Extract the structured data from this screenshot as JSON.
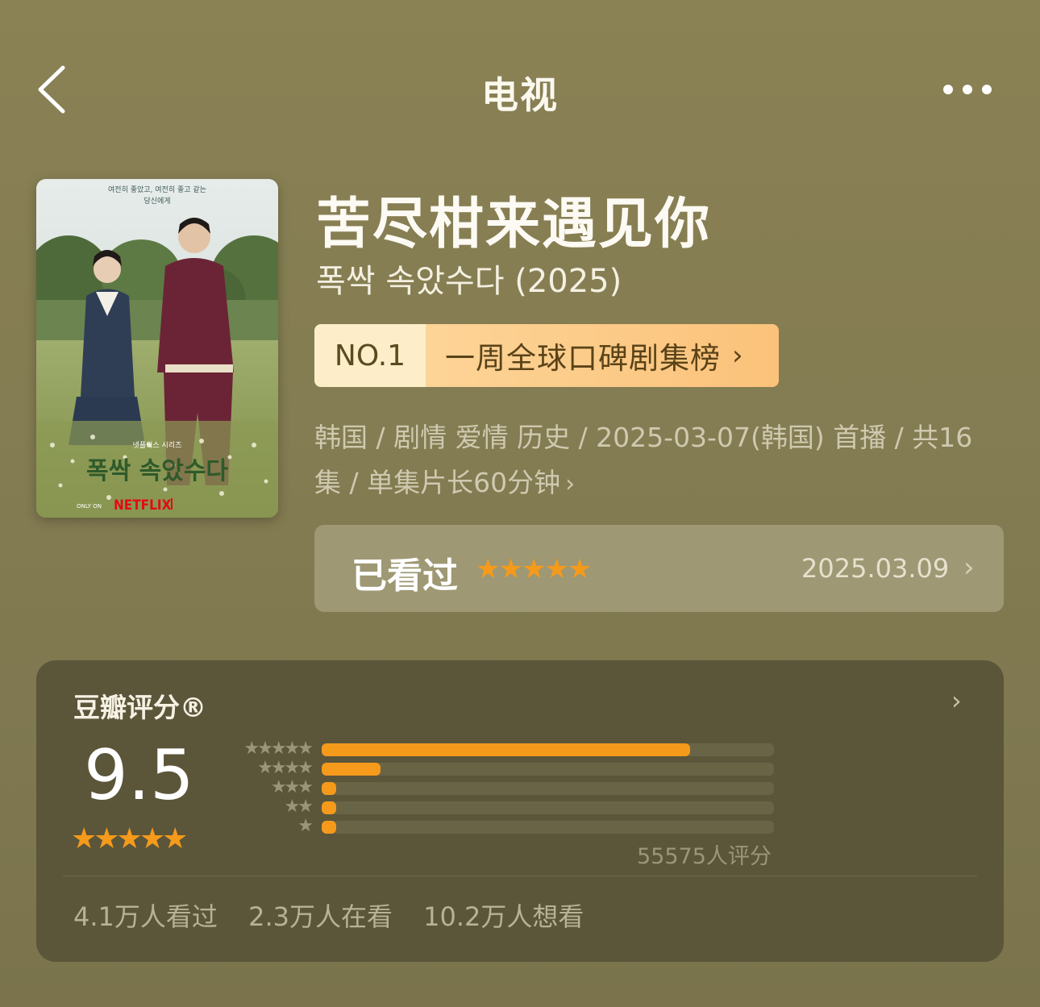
{
  "header": {
    "title": "电视",
    "back_icon": "chevron-left-icon",
    "more_icon": "more-dots-icon"
  },
  "poster": {
    "top_caption_line1": "여전히 좋았고, 여전히 좋고 같는",
    "top_caption_line2": "당신에게",
    "series_tag": "넷플릭스 시리즈",
    "poster_title": "폭싹 속았수다",
    "only_on": "ONLY ON",
    "brand": "NETFLIX",
    "brand_color": "#e50914"
  },
  "title": {
    "main": "苦尽柑来遇见你",
    "original": "폭싹 속았수다 (2025)"
  },
  "rank_badge": {
    "rank": "NO.1",
    "label": "一周全球口碑剧集榜",
    "chevron": "›"
  },
  "meta": {
    "text": "韩国 / 剧情 爱情 历史 / 2025-03-07(韩国) 首播 / 共16集 / 单集片长60分钟",
    "chevron": "›"
  },
  "watched": {
    "label": "已看过",
    "stars": "★★★★★",
    "user_rating": 5,
    "date": "2025.03.09",
    "chevron": "›"
  },
  "rating": {
    "title": "豆瓣评分®",
    "chevron": "›",
    "score": "9.5",
    "stars": "★★★★★",
    "count_label": "55575人评分",
    "distribution": [
      {
        "stars": "★★★★★",
        "fraction": 0.815
      },
      {
        "stars": "★★★★",
        "fraction": 0.13
      },
      {
        "stars": "★★★",
        "fraction": 0.03
      },
      {
        "stars": "★★",
        "fraction": 0.03
      },
      {
        "stars": "★",
        "fraction": 0.03
      }
    ],
    "accent_color": "#f59a1b"
  },
  "stats": {
    "watched": "4.1万人看过",
    "watching": "2.3万人在看",
    "want": "10.2万人想看"
  }
}
